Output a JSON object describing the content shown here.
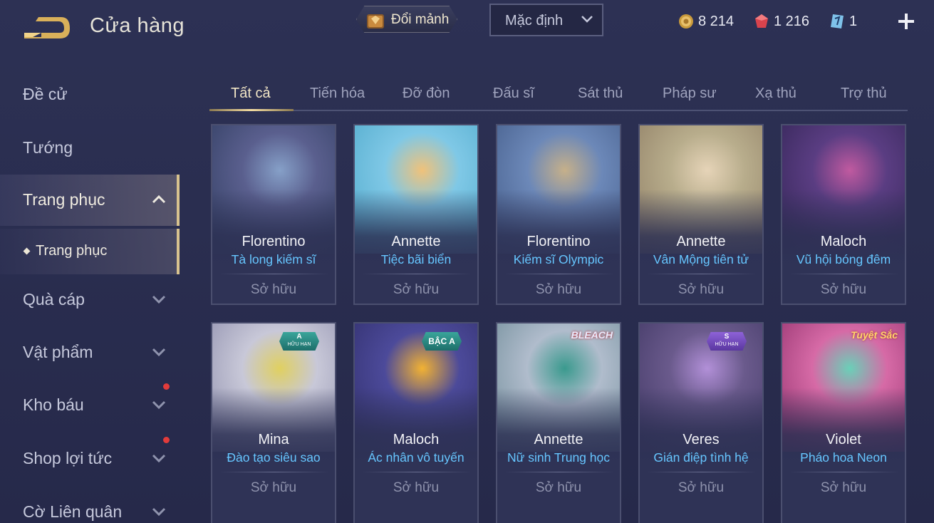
{
  "header": {
    "title": "Cửa hàng",
    "exchange_label": "Đổi mảnh",
    "sort_value": "Mặc định",
    "currencies": {
      "gold": "8 214",
      "gems": "1 216",
      "vouchers": "1"
    }
  },
  "sidebar": {
    "items": [
      {
        "label": "Đề cử"
      },
      {
        "label": "Tướng"
      },
      {
        "label": "Trang phục"
      },
      {
        "label": "Quà cáp"
      },
      {
        "label": "Vật phẩm"
      },
      {
        "label": "Kho báu"
      },
      {
        "label": "Shop lợi tức"
      },
      {
        "label": "Cờ Liên quân"
      }
    ],
    "sub_item": "Trang phục"
  },
  "tabs": [
    "Tất cả",
    "Tiến hóa",
    "Đỡ đòn",
    "Đấu sĩ",
    "Sát thủ",
    "Pháp sư",
    "Xạ thủ",
    "Trợ thủ"
  ],
  "cards": [
    {
      "hero": "Florentino",
      "skin": "Tà long kiếm sĩ",
      "status": "Sở hữu",
      "colors": [
        "#5a5f8e",
        "#2c3a5c",
        "#86a0c8"
      ]
    },
    {
      "hero": "Annette",
      "skin": "Tiệc bãi biển",
      "status": "Sở hữu",
      "colors": [
        "#7fc8e6",
        "#4aa6c8",
        "#f0c27a"
      ]
    },
    {
      "hero": "Florentino",
      "skin": "Kiếm sĩ Olympic",
      "status": "Sở hữu",
      "colors": [
        "#6c88b8",
        "#3f5784",
        "#c6b08a"
      ]
    },
    {
      "hero": "Annette",
      "skin": "Vân Mộng tiên tử",
      "status": "Sở hữu",
      "colors": [
        "#b8ad8c",
        "#8a7860",
        "#e6d4b8"
      ]
    },
    {
      "hero": "Maloch",
      "skin": "Vũ hội bóng đêm",
      "status": "Sở hữu",
      "colors": [
        "#5a3d82",
        "#2e2250",
        "#c05aa0"
      ]
    },
    {
      "hero": "Mina",
      "skin": "Đào tạo siêu sao",
      "status": "Sở hữu",
      "colors": [
        "#c8c8d8",
        "#8888a8",
        "#e0d060"
      ],
      "badge": {
        "top": "A",
        "bottom": "HỮU HẠN",
        "style": "teal"
      }
    },
    {
      "hero": "Maloch",
      "skin": "Ác nhân vô tuyến",
      "status": "Sở hữu",
      "colors": [
        "#4c4a9a",
        "#2e2c66",
        "#f2b233"
      ],
      "badge": {
        "top": "BẬC A",
        "bottom": "",
        "style": "single"
      }
    },
    {
      "hero": "Annette",
      "skin": "Nữ sinh Trung học",
      "status": "Sở hữu",
      "colors": [
        "#b0bccc",
        "#6a8894",
        "#3a9a8e"
      ],
      "logo": "BLEACH"
    },
    {
      "hero": "Veres",
      "skin": "Gián điệp tình hệ",
      "status": "Sở hữu",
      "colors": [
        "#6a5a8c",
        "#3c3460",
        "#b290d8"
      ],
      "badge": {
        "top": "S",
        "bottom": "HỮU HẠN",
        "style": "purple"
      }
    },
    {
      "hero": "Violet",
      "skin": "Pháo hoa Neon",
      "status": "Sở hữu",
      "colors": [
        "#d66aa6",
        "#8a2a66",
        "#6ad0b8"
      ],
      "logo": "Tuyệt Sắc"
    }
  ]
}
